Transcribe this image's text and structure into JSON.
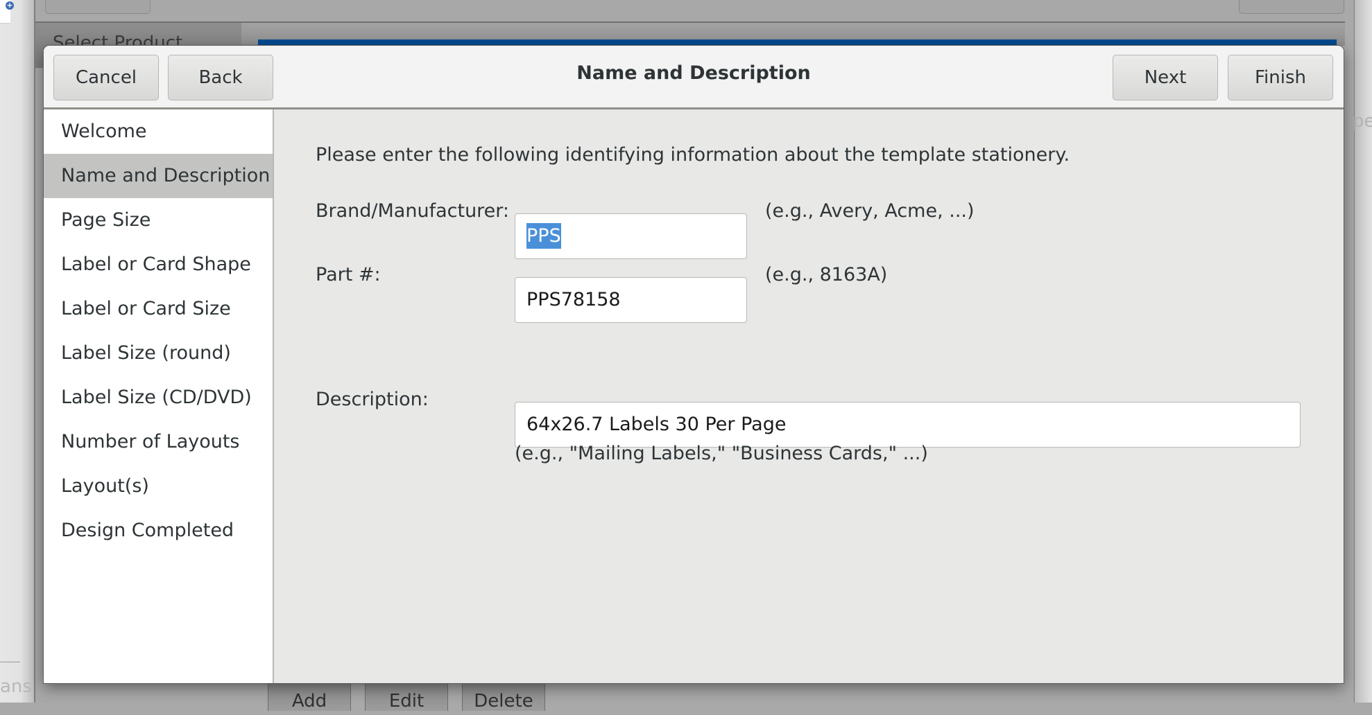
{
  "background": {
    "parent_tab_label": "Select Product",
    "bottom_buttons": [
      "Add",
      "Edit",
      "Delete"
    ],
    "left_partial_text": "ans",
    "right_partial_text": "pe",
    "add_icon_glyph": "+"
  },
  "dialog": {
    "title": "Name and Description",
    "buttons": {
      "cancel": "Cancel",
      "back": "Back",
      "next": "Next",
      "finish": "Finish"
    },
    "steps": [
      {
        "label": "Welcome",
        "selected": false
      },
      {
        "label": "Name and Description",
        "selected": true
      },
      {
        "label": "Page Size",
        "selected": false
      },
      {
        "label": "Label or Card Shape",
        "selected": false
      },
      {
        "label": "Label or Card Size",
        "selected": false
      },
      {
        "label": "Label Size (round)",
        "selected": false
      },
      {
        "label": "Label Size (CD/DVD)",
        "selected": false
      },
      {
        "label": "Number of Layouts",
        "selected": false
      },
      {
        "label": "Layout(s)",
        "selected": false
      },
      {
        "label": "Design Completed",
        "selected": false
      }
    ],
    "form": {
      "intro": "Please enter the following identifying information about the template stationery.",
      "brand": {
        "label": "Brand/Manufacturer:",
        "value": "PPS",
        "hint": "(e.g., Avery, Acme, ...)"
      },
      "part": {
        "label": "Part #:",
        "value": "PPS78158",
        "hint": "(e.g., 8163A)"
      },
      "description": {
        "label": "Description:",
        "value": "64x26.7 Labels 30 Per Page",
        "hint": "(e.g., \"Mailing Labels,\" \"Business Cards,\" ...)"
      }
    }
  },
  "colors": {
    "selection": "#4a90d9",
    "sidebar_selected": "#c3c4c2",
    "parent_accent_bar": "#004b93"
  }
}
